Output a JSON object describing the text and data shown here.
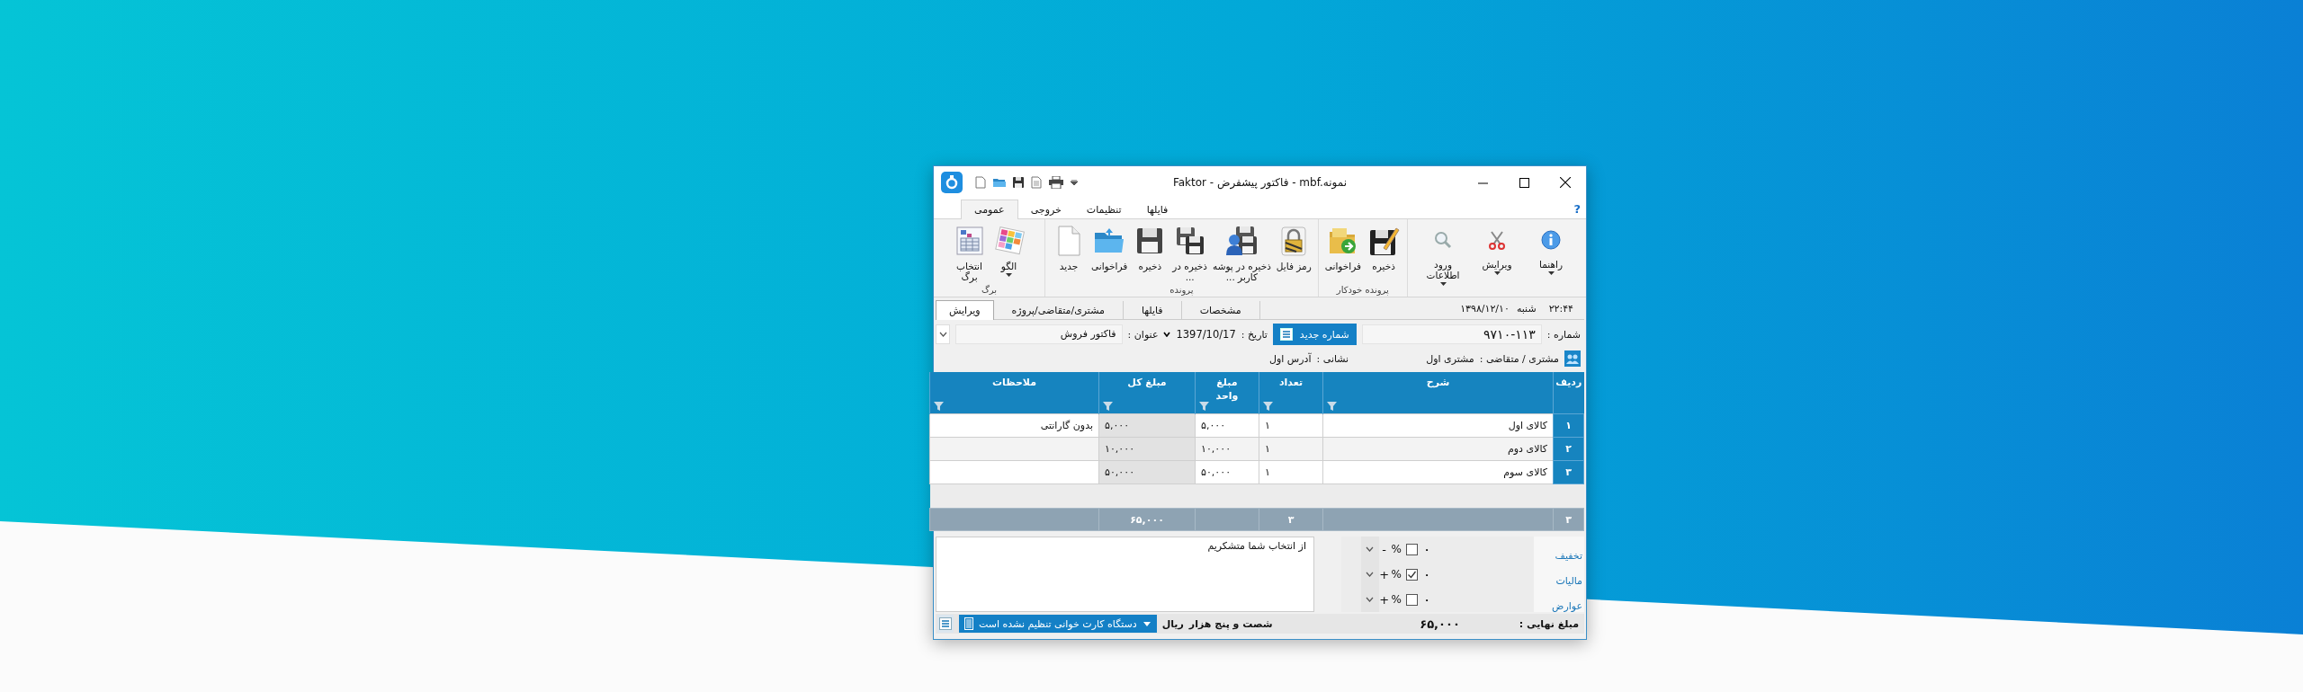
{
  "window": {
    "title": "Faktor - فاکتور پیشفرض - mbf.نمونه"
  },
  "ribbon_tabs": [
    {
      "label": "فایلها",
      "selected": false
    },
    {
      "label": "تنظیمات",
      "selected": false
    },
    {
      "label": "خروجی",
      "selected": false
    },
    {
      "label": "عمومی",
      "selected": true
    }
  ],
  "help_label": "?",
  "ribbon_groups": [
    {
      "buttons": [
        {
          "label": "راهنما",
          "dropdown": true
        },
        {
          "label": "ویرایش",
          "dropdown": true
        },
        {
          "label": "ورود\nاطلاعات",
          "dropdown": true
        }
      ]
    },
    {
      "label": "پرونده خودکار",
      "buttons": [
        {
          "label": "ذخیره",
          "dropdown": false
        },
        {
          "label": "فراخوانی",
          "dropdown": false
        }
      ]
    },
    {
      "label": "پرونده",
      "buttons": [
        {
          "label": "رمز فایل",
          "dropdown": false
        },
        {
          "label": "ذخیره در پوشه\nکاربر ...",
          "dropdown": false
        },
        {
          "label": "ذخیره در\n...",
          "dropdown": false
        },
        {
          "label": "ذخیره",
          "dropdown": false
        },
        {
          "label": "فراخوانی",
          "dropdown": false
        },
        {
          "label": "جدید",
          "dropdown": false
        }
      ]
    },
    {
      "label": "برگ",
      "buttons": [
        {
          "label": "الگو",
          "dropdown": true
        },
        {
          "label": "انتخاب\nبرگ",
          "dropdown": false
        }
      ]
    }
  ],
  "clock": {
    "time": "۲۲:۴۴",
    "day": "شنبه",
    "date": "۱۳۹۸/۱۲/۱۰"
  },
  "document_tabs": [
    {
      "label": "مشخصات",
      "selected": false
    },
    {
      "label": "فایلها",
      "selected": false
    },
    {
      "label": "مشتری/متقاضی/پروژه",
      "selected": false
    },
    {
      "label": "ویرایش",
      "selected": true
    }
  ],
  "invoice": {
    "number_label": "شماره :",
    "number": "۹۷۱۰-۱۱۳",
    "new_number_button": "شماره جدید",
    "date_label": "تاریخ :",
    "date": "1397/10/17",
    "title_label": "عنوان :",
    "title": "فاکتور فروش",
    "customer_label": "مشتری / متقاضی :",
    "customer": "مشتری اول",
    "address_label": "نشانی :",
    "address": "آدرس اول"
  },
  "table": {
    "columns": [
      "ردیف",
      "شرح",
      "تعداد",
      "مبلغ\nواحد",
      "مبلغ کل",
      "ملاحظات"
    ],
    "rows": [
      {
        "index": "۱",
        "description": "کالای اول",
        "quantity": "۱",
        "unit_price": "۵,۰۰۰",
        "total": "۵,۰۰۰",
        "remarks": "بدون گارانتی"
      },
      {
        "index": "۲",
        "description": "کالای دوم",
        "quantity": "۱",
        "unit_price": "۱۰,۰۰۰",
        "total": "۱۰,۰۰۰"
      },
      {
        "index": "۳",
        "description": "کالای سوم",
        "quantity": "۱",
        "unit_price": "۵۰,۰۰۰",
        "total": "۵۰,۰۰۰"
      }
    ],
    "totals": {
      "row_count": "۳",
      "quantity": "۳",
      "total": "۶۵,۰۰۰"
    }
  },
  "adjustments": [
    {
      "label": "تخفیف",
      "value": "۰",
      "checked": false,
      "unit": "%",
      "sign": "-"
    },
    {
      "label": "مالیات",
      "value": "۰",
      "checked": true,
      "unit": "%",
      "sign": "+"
    },
    {
      "label": "عوارض",
      "value": "۰",
      "checked": false,
      "unit": "%",
      "sign": "+"
    }
  ],
  "notes": "از انتخاب شما متشکریم",
  "status_bar": {
    "final_label": "مبلغ نهایی :",
    "final_amount": "۶۵,۰۰۰",
    "amount_words": "شصت و پنج هزار",
    "currency": "ریال",
    "card_reader": "دستگاه کارت خوانی تنظیم نشده است"
  }
}
